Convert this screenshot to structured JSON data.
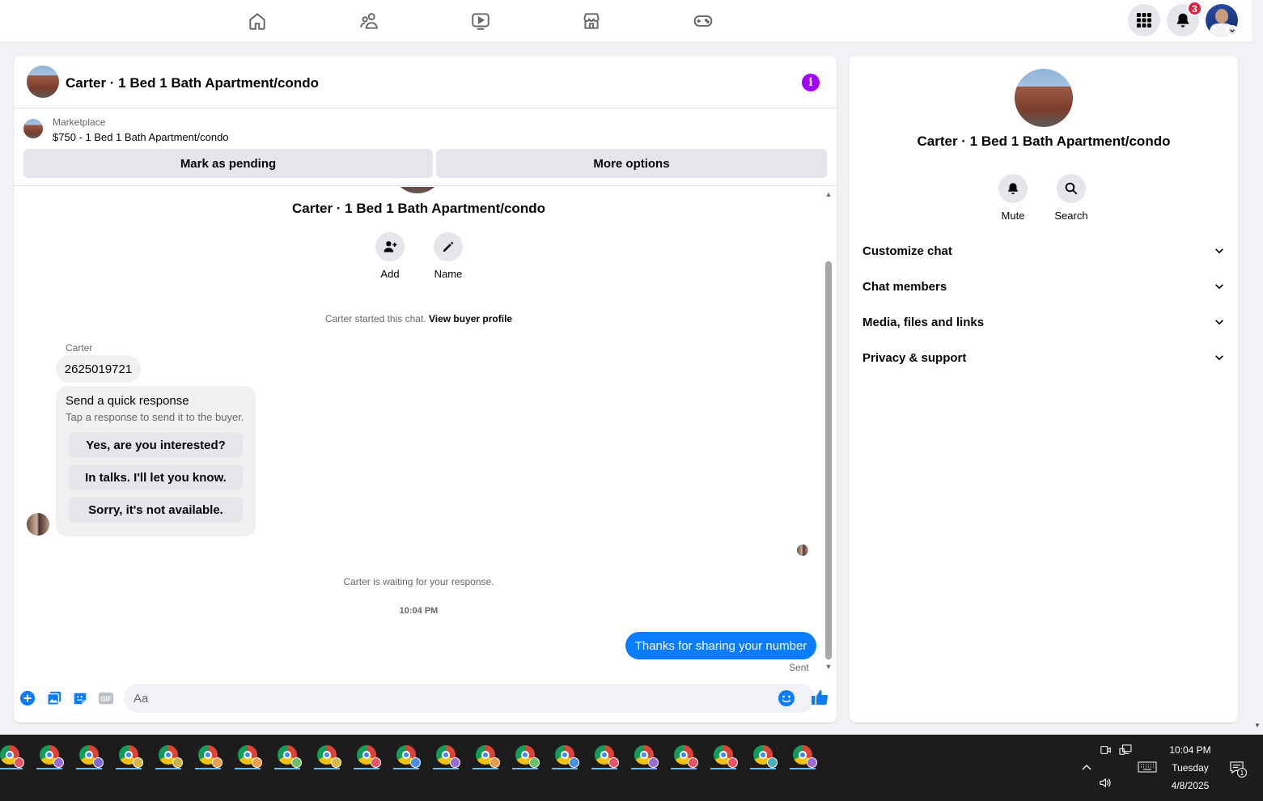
{
  "topnav": {
    "icons": [
      "home-icon",
      "friends-icon",
      "watch-icon",
      "marketplace-icon",
      "gaming-icon"
    ],
    "notification_count": "3"
  },
  "chat": {
    "title": "Carter · 1 Bed 1 Bath Apartment/condo",
    "marketplace_label": "Marketplace",
    "listing": "$750 - 1 Bed 1 Bath Apartment/condo",
    "mark_pending": "Mark as pending",
    "more_options": "More options",
    "center_title": "Carter · 1 Bed 1 Bath Apartment/condo",
    "actions": {
      "add": "Add",
      "name": "Name"
    },
    "started_text": "Carter started this chat.",
    "view_buyer_profile": "View buyer profile",
    "sender_name": "Carter",
    "phone_message": "2625019721",
    "quick_response": {
      "title": "Send a quick response",
      "subtitle": "Tap a response to send it to the buyer.",
      "options": [
        "Yes, are you interested?",
        "In talks. I'll let you know.",
        "Sorry, it's not available."
      ]
    },
    "waiting_text": "Carter is waiting for your response.",
    "timestamp": "10:04 PM",
    "my_message": "Thanks for sharing your number",
    "sent_status": "Sent",
    "composer_placeholder": "Aa"
  },
  "info_panel": {
    "title": "Carter · 1 Bed 1 Bath Apartment/condo",
    "mute": "Mute",
    "search": "Search",
    "sections": [
      "Customize chat",
      "Chat members",
      "Media, files and links",
      "Privacy & support"
    ]
  },
  "taskbar": {
    "time": "10:04 PM",
    "day": "Tuesday",
    "date": "4/8/2025",
    "notification_count": "1",
    "profile_badge_colors": [
      "#e8556b",
      "#9a6cd8",
      "#7a6cd8",
      "#d6b84a",
      "#c9b24a",
      "#e8a04a",
      "#e8a04a",
      "#6cc06c",
      "#d6b84a",
      "#e8556b",
      "#4a90e0",
      "#9a6cd8",
      "#e89a4a",
      "#6cc06c",
      "#4a90e0",
      "#e8556b",
      "#9a6cd8",
      "#e8556b",
      "#e8556b",
      "#4ab0c0",
      "#9a6cd8"
    ]
  }
}
